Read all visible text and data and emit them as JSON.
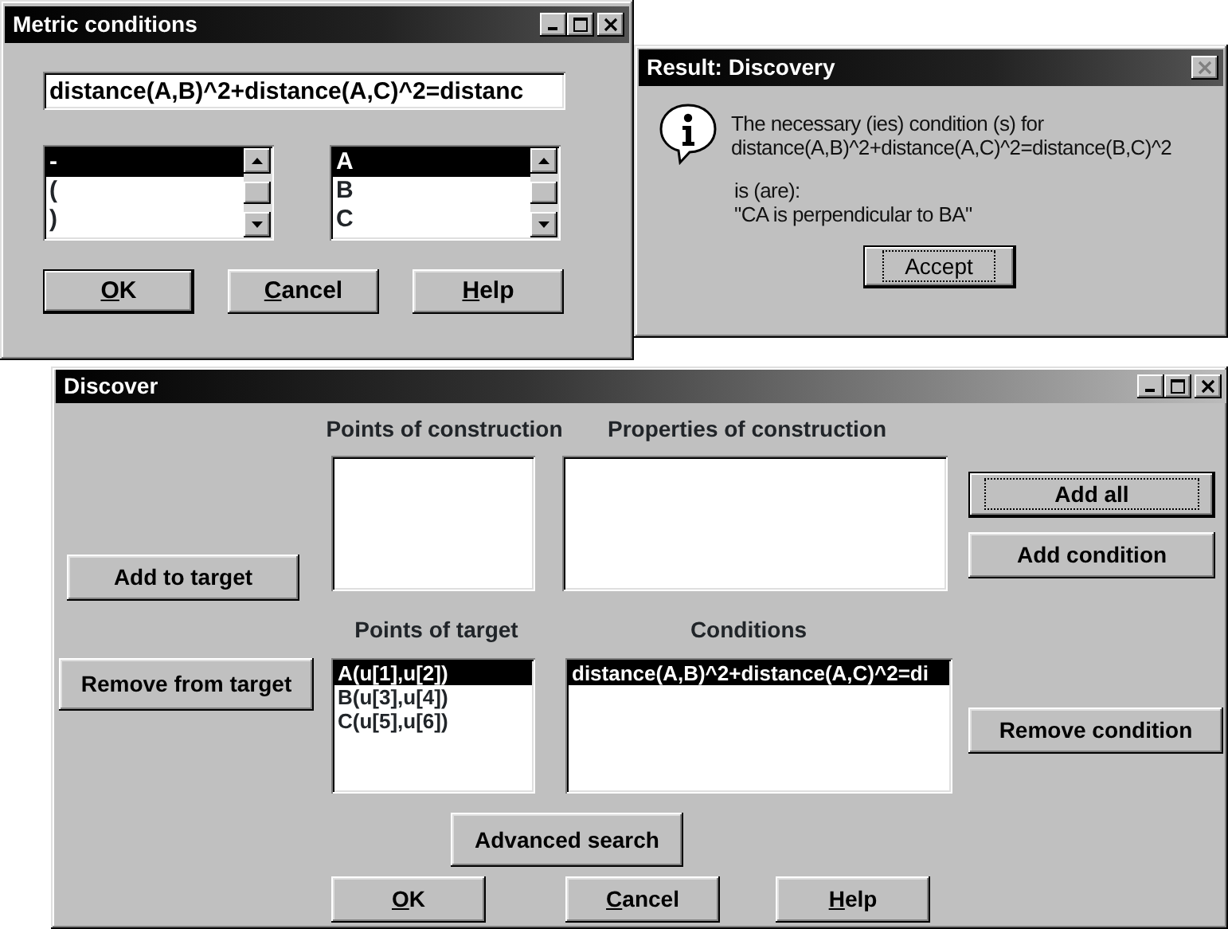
{
  "metric_dialog": {
    "title": "Metric conditions",
    "expression": {
      "value": "distance(A,B)^2+distance(A,C)^2=distanc"
    },
    "lists": [
      {
        "items": [
          {
            "label": "-",
            "selected": true
          },
          {
            "label": "(",
            "selected": false
          },
          {
            "label": ")",
            "selected": false
          }
        ]
      },
      {
        "items": [
          {
            "label": "A",
            "selected": true
          },
          {
            "label": "B",
            "selected": false
          },
          {
            "label": "C",
            "selected": false
          }
        ]
      }
    ],
    "buttons": [
      {
        "accel": "O",
        "rest": "K",
        "default": true
      },
      {
        "accel": "C",
        "rest": "ancel",
        "default": false
      },
      {
        "accel": "H",
        "rest": "elp",
        "default": false
      }
    ]
  },
  "result_dialog": {
    "title": "Result: Discovery",
    "paragraphs": [
      [
        "The necessary (ies) condition (s) for",
        "distance(A,B)^2+distance(A,C)^2=distance(B,C)^2"
      ],
      [
        "is (are):",
        "\"CA is perpendicular to BA\""
      ]
    ],
    "buttons": [
      {
        "label": "Accept",
        "focused": true
      }
    ]
  },
  "discover_dialog": {
    "title": "Discover",
    "points_of_construction": {
      "label": "Points of construction"
    },
    "properties_of_construction": {
      "label": "Properties of construction"
    },
    "points_of_target": {
      "label": "Points of target",
      "items": [
        {
          "label": "A(u[1],u[2])",
          "selected": true
        },
        {
          "label": "B(u[3],u[4])",
          "selected": false
        },
        {
          "label": "C(u[5],u[6])",
          "selected": false
        }
      ]
    },
    "conditions": {
      "label": "Conditions",
      "items": [
        {
          "label": "distance(A,B)^2+distance(A,C)^2=di",
          "selected": true
        }
      ]
    },
    "side_buttons": [
      {
        "label": "Add to target",
        "focused": false
      },
      {
        "label": "Remove from target",
        "focused": false
      }
    ],
    "right_buttons": [
      {
        "label": "Add all",
        "focused": true
      },
      {
        "label": "Add condition",
        "focused": false
      },
      {
        "label": "Remove condition",
        "focused": false
      }
    ],
    "advanced_button": {
      "label": "Advanced search"
    },
    "buttons": [
      {
        "accel": "O",
        "rest": "K"
      },
      {
        "accel": "C",
        "rest": "ancel"
      },
      {
        "accel": "H",
        "rest": "elp"
      }
    ]
  }
}
